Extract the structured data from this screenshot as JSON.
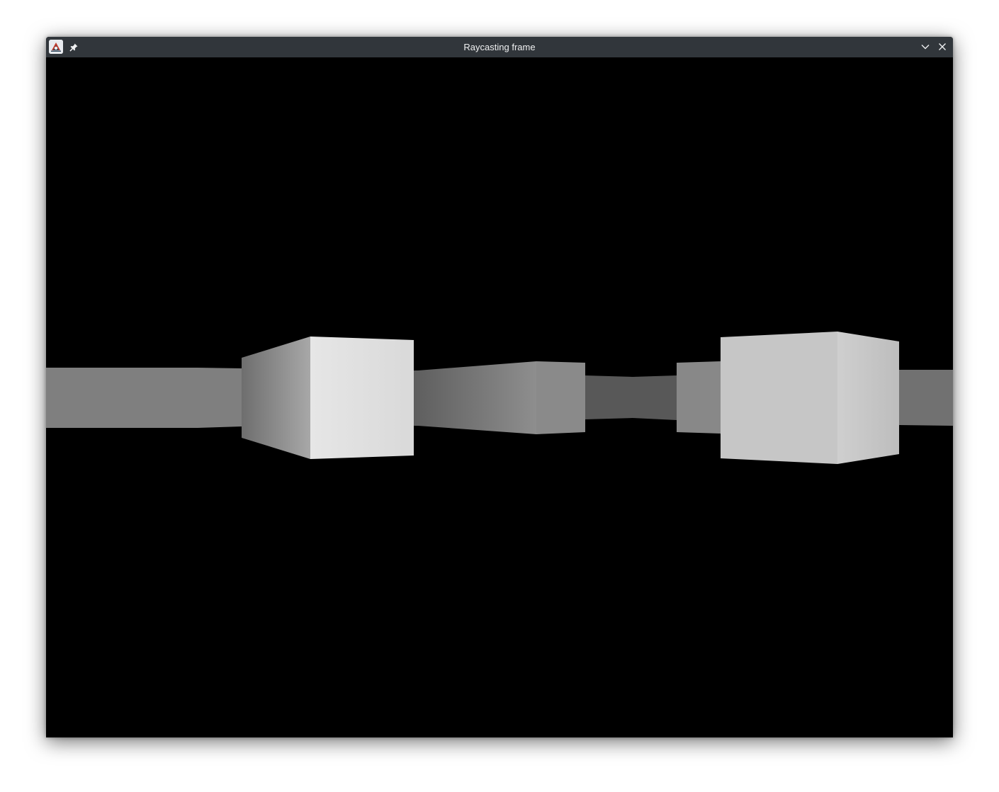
{
  "window": {
    "title": "Raycasting frame"
  },
  "titlebar": {
    "app_icon": "java-app-icon",
    "buttons": [
      {
        "name": "pin",
        "icon": "pin-icon"
      },
      {
        "name": "minimize",
        "icon": "chevron-down-icon"
      },
      {
        "name": "close",
        "icon": "close-icon"
      }
    ]
  },
  "scene": {
    "background_color": "#000000",
    "wall_segments": [
      {
        "name": "wall-far-left",
        "shade_from": "#7f7f7f",
        "shade_to": "#7f7f7f"
      },
      {
        "name": "wall-left-block-side",
        "shade_from": "#6e6e6e",
        "shade_to": "#a8a8a8"
      },
      {
        "name": "wall-left-block-front",
        "shade_from": "#e6e6e6",
        "shade_to": "#d9d9d9"
      },
      {
        "name": "wall-corridor-left",
        "shade_from": "#5e5e5e",
        "shade_to": "#8e8e8e"
      },
      {
        "name": "wall-corridor-mid",
        "shade_from": "#8a8a8a",
        "shade_to": "#8a8a8a"
      },
      {
        "name": "wall-corridor-far",
        "shade_from": "#565656",
        "shade_to": "#5a5a5a"
      },
      {
        "name": "wall-corridor-right",
        "shade_from": "#888888",
        "shade_to": "#888888"
      },
      {
        "name": "wall-right-block-front",
        "shade_from": "#c6c6c6",
        "shade_to": "#c6c6c6"
      },
      {
        "name": "wall-right-block-side",
        "shade_from": "#cfcfcf",
        "shade_to": "#bdbdbd"
      },
      {
        "name": "wall-far-right",
        "shade_from": "#717171",
        "shade_to": "#717171"
      }
    ]
  }
}
